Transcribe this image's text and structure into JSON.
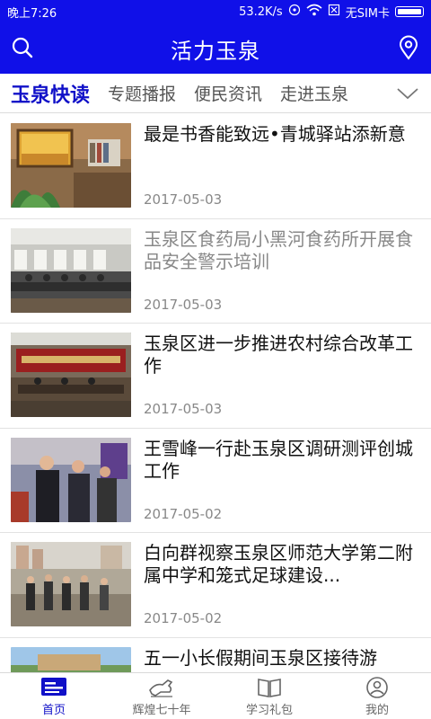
{
  "status": {
    "time": "晚上7:26",
    "speed": "53.2K/s",
    "sim": "无SIM卡"
  },
  "header": {
    "title": "活力玉泉",
    "search_icon": "search-icon",
    "location_icon": "location-pin-icon"
  },
  "tabs": [
    {
      "label": "玉泉快读"
    },
    {
      "label": "专题播报"
    },
    {
      "label": "便民资讯"
    },
    {
      "label": "走进玉泉"
    }
  ],
  "articles": [
    {
      "title": "最是书香能致远•青城驿站添新意",
      "date": "2017-05-03",
      "read": false
    },
    {
      "title": "玉泉区食药局小黑河食药所开展食品安全警示培训",
      "date": "2017-05-03",
      "read": true
    },
    {
      "title": "玉泉区进一步推进农村综合改革工作",
      "date": "2017-05-03",
      "read": false
    },
    {
      "title": "王雪峰一行赴玉泉区调研测评创城工作",
      "date": "2017-05-02",
      "read": false
    },
    {
      "title": "白向群视察玉泉区师范大学第二附属中学和笼式足球建设...",
      "date": "2017-05-02",
      "read": false
    },
    {
      "title": "五一小长假期间玉泉区接待游",
      "date": "",
      "read": false
    }
  ],
  "bottom_nav": [
    {
      "label": "首页",
      "icon": "home-news-icon"
    },
    {
      "label": "辉煌七十年",
      "icon": "horse-icon"
    },
    {
      "label": "学习礼包",
      "icon": "book-icon"
    },
    {
      "label": "我的",
      "icon": "profile-icon"
    }
  ],
  "colors": {
    "brand": "#1010e8",
    "active_tab": "#1010c8"
  }
}
